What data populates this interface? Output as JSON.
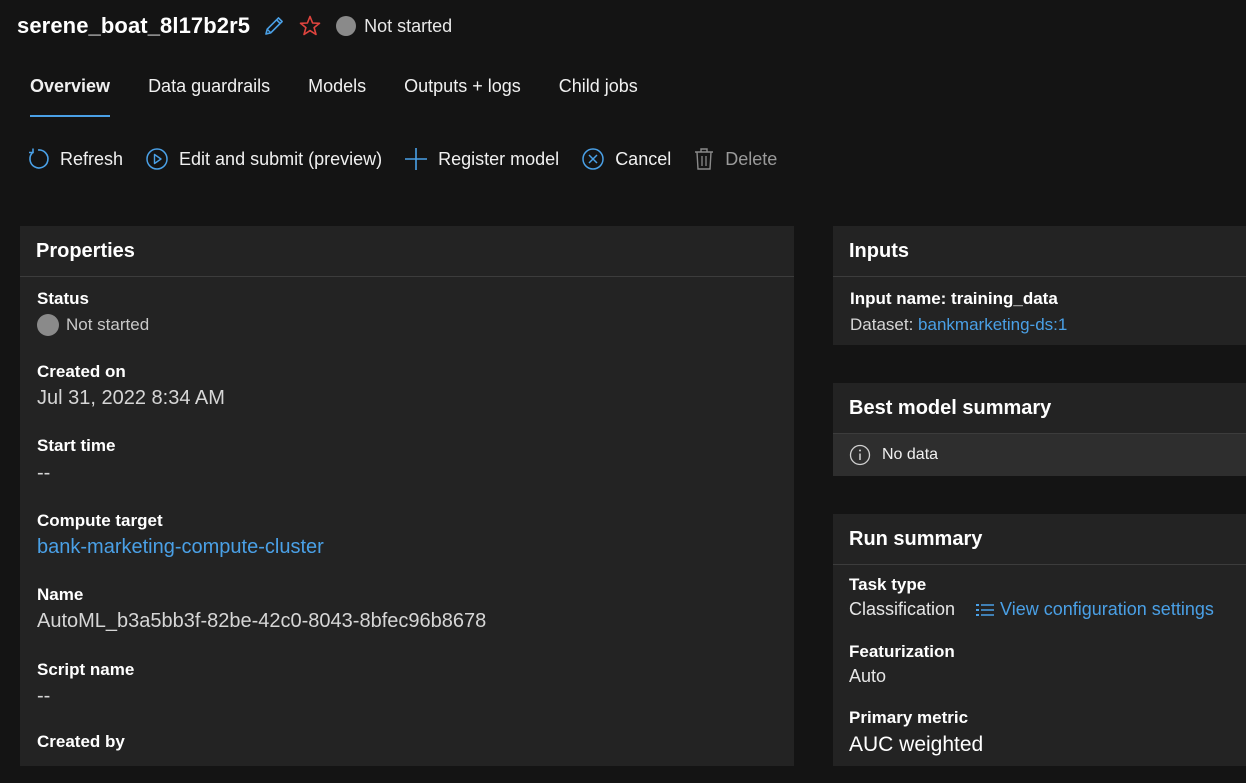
{
  "header": {
    "title": "serene_boat_8l17b2r5",
    "status": "Not started",
    "icons": {
      "edit": "pencil-icon",
      "favorite": "star-icon",
      "status": "status-dot-icon"
    },
    "colors": {
      "accent": "#4aa0e6",
      "star": "#e0443e",
      "status_dot": "#8a8a8a"
    }
  },
  "tabs": [
    {
      "label": "Overview",
      "active": true
    },
    {
      "label": "Data guardrails"
    },
    {
      "label": "Models"
    },
    {
      "label": "Outputs + logs"
    },
    {
      "label": "Child jobs"
    }
  ],
  "toolbar": {
    "refresh": "Refresh",
    "edit_submit": "Edit and submit (preview)",
    "register": "Register model",
    "cancel": "Cancel",
    "delete": "Delete"
  },
  "properties": {
    "title": "Properties",
    "status_label": "Status",
    "status_value": "Not started",
    "created_on_label": "Created on",
    "created_on_value": "Jul 31, 2022 8:34 AM",
    "start_time_label": "Start time",
    "start_time_value": "--",
    "compute_label": "Compute target",
    "compute_value": "bank-marketing-compute-cluster",
    "name_label": "Name",
    "name_value": "AutoML_b3a5bb3f-82be-42c0-8043-8bfec96b8678",
    "script_label": "Script name",
    "script_value": "--",
    "created_by_label": "Created by"
  },
  "inputs": {
    "title": "Inputs",
    "input_name": "Input name: training_data",
    "dataset_prefix": "Dataset: ",
    "dataset_link": "bankmarketing-ds:1"
  },
  "best_model": {
    "title": "Best model summary",
    "no_data": "No data"
  },
  "run_summary": {
    "title": "Run summary",
    "task_type_label": "Task type",
    "task_type_value": "Classification",
    "view_config": "View configuration settings",
    "featurization_label": "Featurization",
    "featurization_value": "Auto",
    "primary_metric_label": "Primary metric",
    "primary_metric_value": "AUC weighted"
  }
}
